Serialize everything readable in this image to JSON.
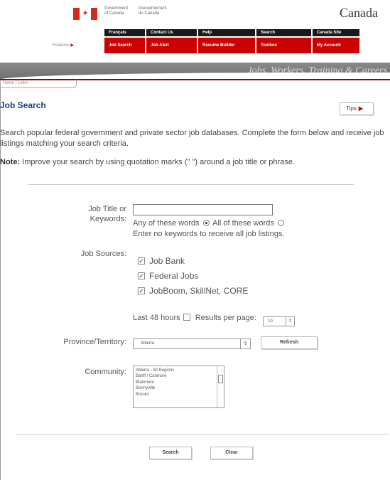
{
  "header": {
    "gov_en_1": "Government",
    "gov_en_2": "of Canada",
    "gov_fr_1": "Gouvernement",
    "gov_fr_2": "du Canada",
    "wordmark": "Canada",
    "maple_leaf": "maple-leaf-icon"
  },
  "nav_top": [
    "Français",
    "Contact Us",
    "Help",
    "Search",
    "Canada Site"
  ],
  "nav_features_label": "Features",
  "nav_features": [
    "Job Search",
    "Job Alert",
    "Resume Builder",
    "Toolbox",
    "My Account"
  ],
  "banner": {
    "title": "Jobs, Workers, Training & Careers",
    "breadcrumb": "Home | Links"
  },
  "page": {
    "title": "Job Search",
    "tips_label": "Tips",
    "intro": "Search popular federal government and private sector job databases. Complete the form below and receive job listings matching your search criteria.",
    "note_label": "Note:",
    "note_text": " Improve your search by using quotation marks (\" \") around a job title or phrase."
  },
  "form": {
    "keywords_label_1": "Job Title or",
    "keywords_label_2": "Keywords:",
    "keywords_value": "",
    "any_words": "Any of these words",
    "all_words": "All of these words",
    "no_keywords_hint": "Enter no keywords to receive all job listings.",
    "sources_label": "Job Sources:",
    "sources": [
      {
        "label": "Job Bank",
        "checked": true
      },
      {
        "label": "Federal Jobs",
        "checked": true
      },
      {
        "label": "JobBoom, SkillNet, CORE",
        "checked": true
      }
    ],
    "last48_label": "Last 48 hours",
    "results_label": "Results per page:",
    "results_value": "10",
    "province_label": "Province/Territory:",
    "province_value": "Alberta",
    "refresh_label": "Refresh",
    "community_label": "Community:",
    "communities": [
      "Alberta - All Regions",
      "Banff / Canmore",
      "Blairmore",
      "Bonnyville",
      "Brooks"
    ],
    "search_label": "Search",
    "clear_label": "Clear"
  },
  "colors": {
    "nav_top": "#1a1a1a",
    "nav_features": "#cc0000",
    "title": "#1a3d7c"
  }
}
